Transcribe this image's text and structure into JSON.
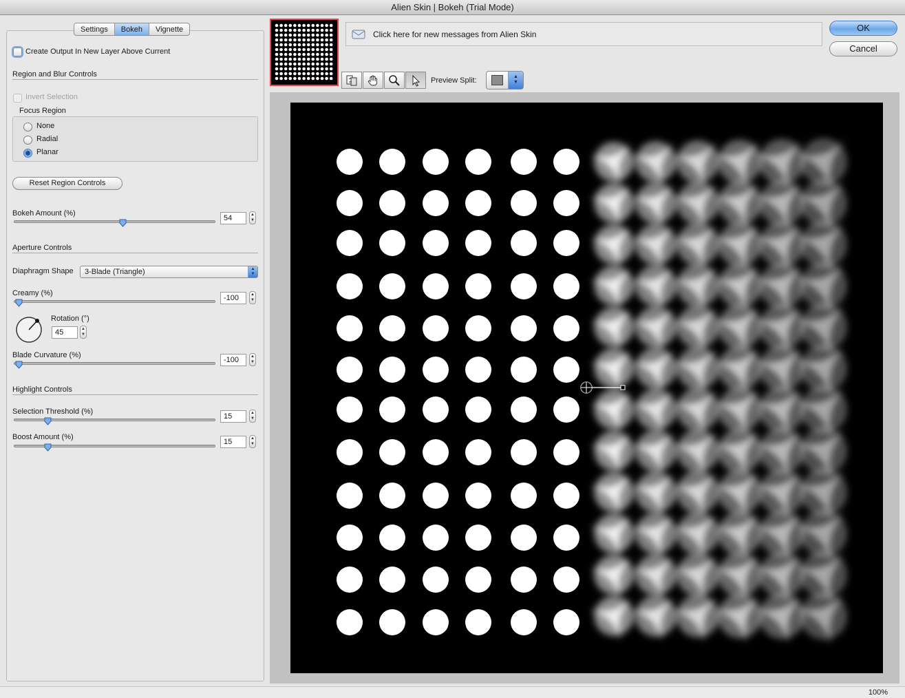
{
  "window": {
    "title": "Alien Skin | Bokeh (Trial Mode)"
  },
  "tabs": [
    {
      "label": "Settings"
    },
    {
      "label": "Bokeh",
      "active": true
    },
    {
      "label": "Vignette"
    }
  ],
  "output": {
    "create_layer_label": "Create Output In New Layer Above Current",
    "checked": false
  },
  "region": {
    "title": "Region and Blur Controls",
    "invert_label": "Invert Selection",
    "focus_region_label": "Focus Region",
    "options": [
      "None",
      "Radial",
      "Planar"
    ],
    "selected": "Planar",
    "reset_label": "Reset Region Controls",
    "bokeh_amount_label": "Bokeh Amount (%)",
    "bokeh_amount": "54"
  },
  "aperture": {
    "title": "Aperture Controls",
    "diaphragm_label": "Diaphragm Shape",
    "diaphragm_value": "3-Blade (Triangle)",
    "creamy_label": "Creamy (%)",
    "creamy_value": "-100",
    "rotation_label": "Rotation (°)",
    "rotation_value": "45",
    "blade_curvature_label": "Blade Curvature (%)",
    "blade_curvature_value": "-100"
  },
  "highlight": {
    "title": "Highlight Controls",
    "threshold_label": "Selection Threshold (%)",
    "threshold_value": "15",
    "boost_label": "Boost Amount (%)",
    "boost_value": "15"
  },
  "messages": {
    "text": "Click here for new messages from Alien Skin"
  },
  "buttons": {
    "ok": "OK",
    "cancel": "Cancel"
  },
  "toolbar": {
    "preview_split_label": "Preview Split:",
    "icons": [
      "split-compare-icon",
      "hand-icon",
      "zoom-icon",
      "pointer-icon"
    ]
  },
  "status": {
    "zoom": "100%"
  },
  "colors": {
    "accent": "#6da8ec",
    "thumbnail_border": "#e2473f",
    "canvas": "#000000"
  }
}
